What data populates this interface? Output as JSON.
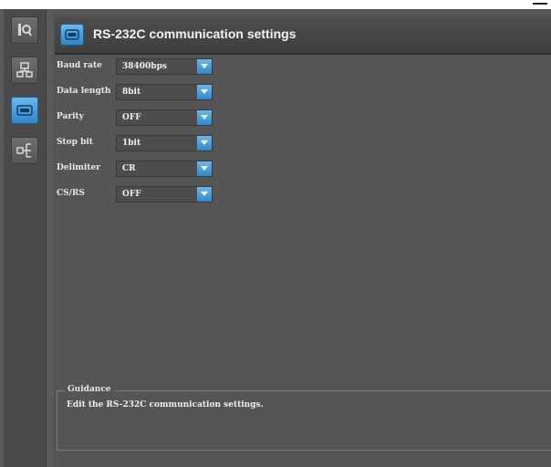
{
  "header": {
    "title": "RS-232C communication settings",
    "icon": "serial-port-icon"
  },
  "sidebar": {
    "items": [
      {
        "icon": "search-icon",
        "active": false
      },
      {
        "icon": "network-icon",
        "active": false
      },
      {
        "icon": "serial-port-icon",
        "active": true
      },
      {
        "icon": "io-tree-icon",
        "active": false
      }
    ]
  },
  "settings": [
    {
      "label": "Baud rate",
      "value": "38400bps"
    },
    {
      "label": "Data length",
      "value": "8bit"
    },
    {
      "label": "Parity",
      "value": "OFF"
    },
    {
      "label": "Stop bit",
      "value": "1bit"
    },
    {
      "label": "Delimiter",
      "value": "CR"
    },
    {
      "label": "CS/RS",
      "value": "OFF"
    }
  ],
  "guidance": {
    "title": "Guidance",
    "text": "Edit the RS-232C communication settings."
  },
  "colors": {
    "accent": "#3a92d4",
    "panel": "#555555",
    "sidebar": "#4a4a4a"
  }
}
